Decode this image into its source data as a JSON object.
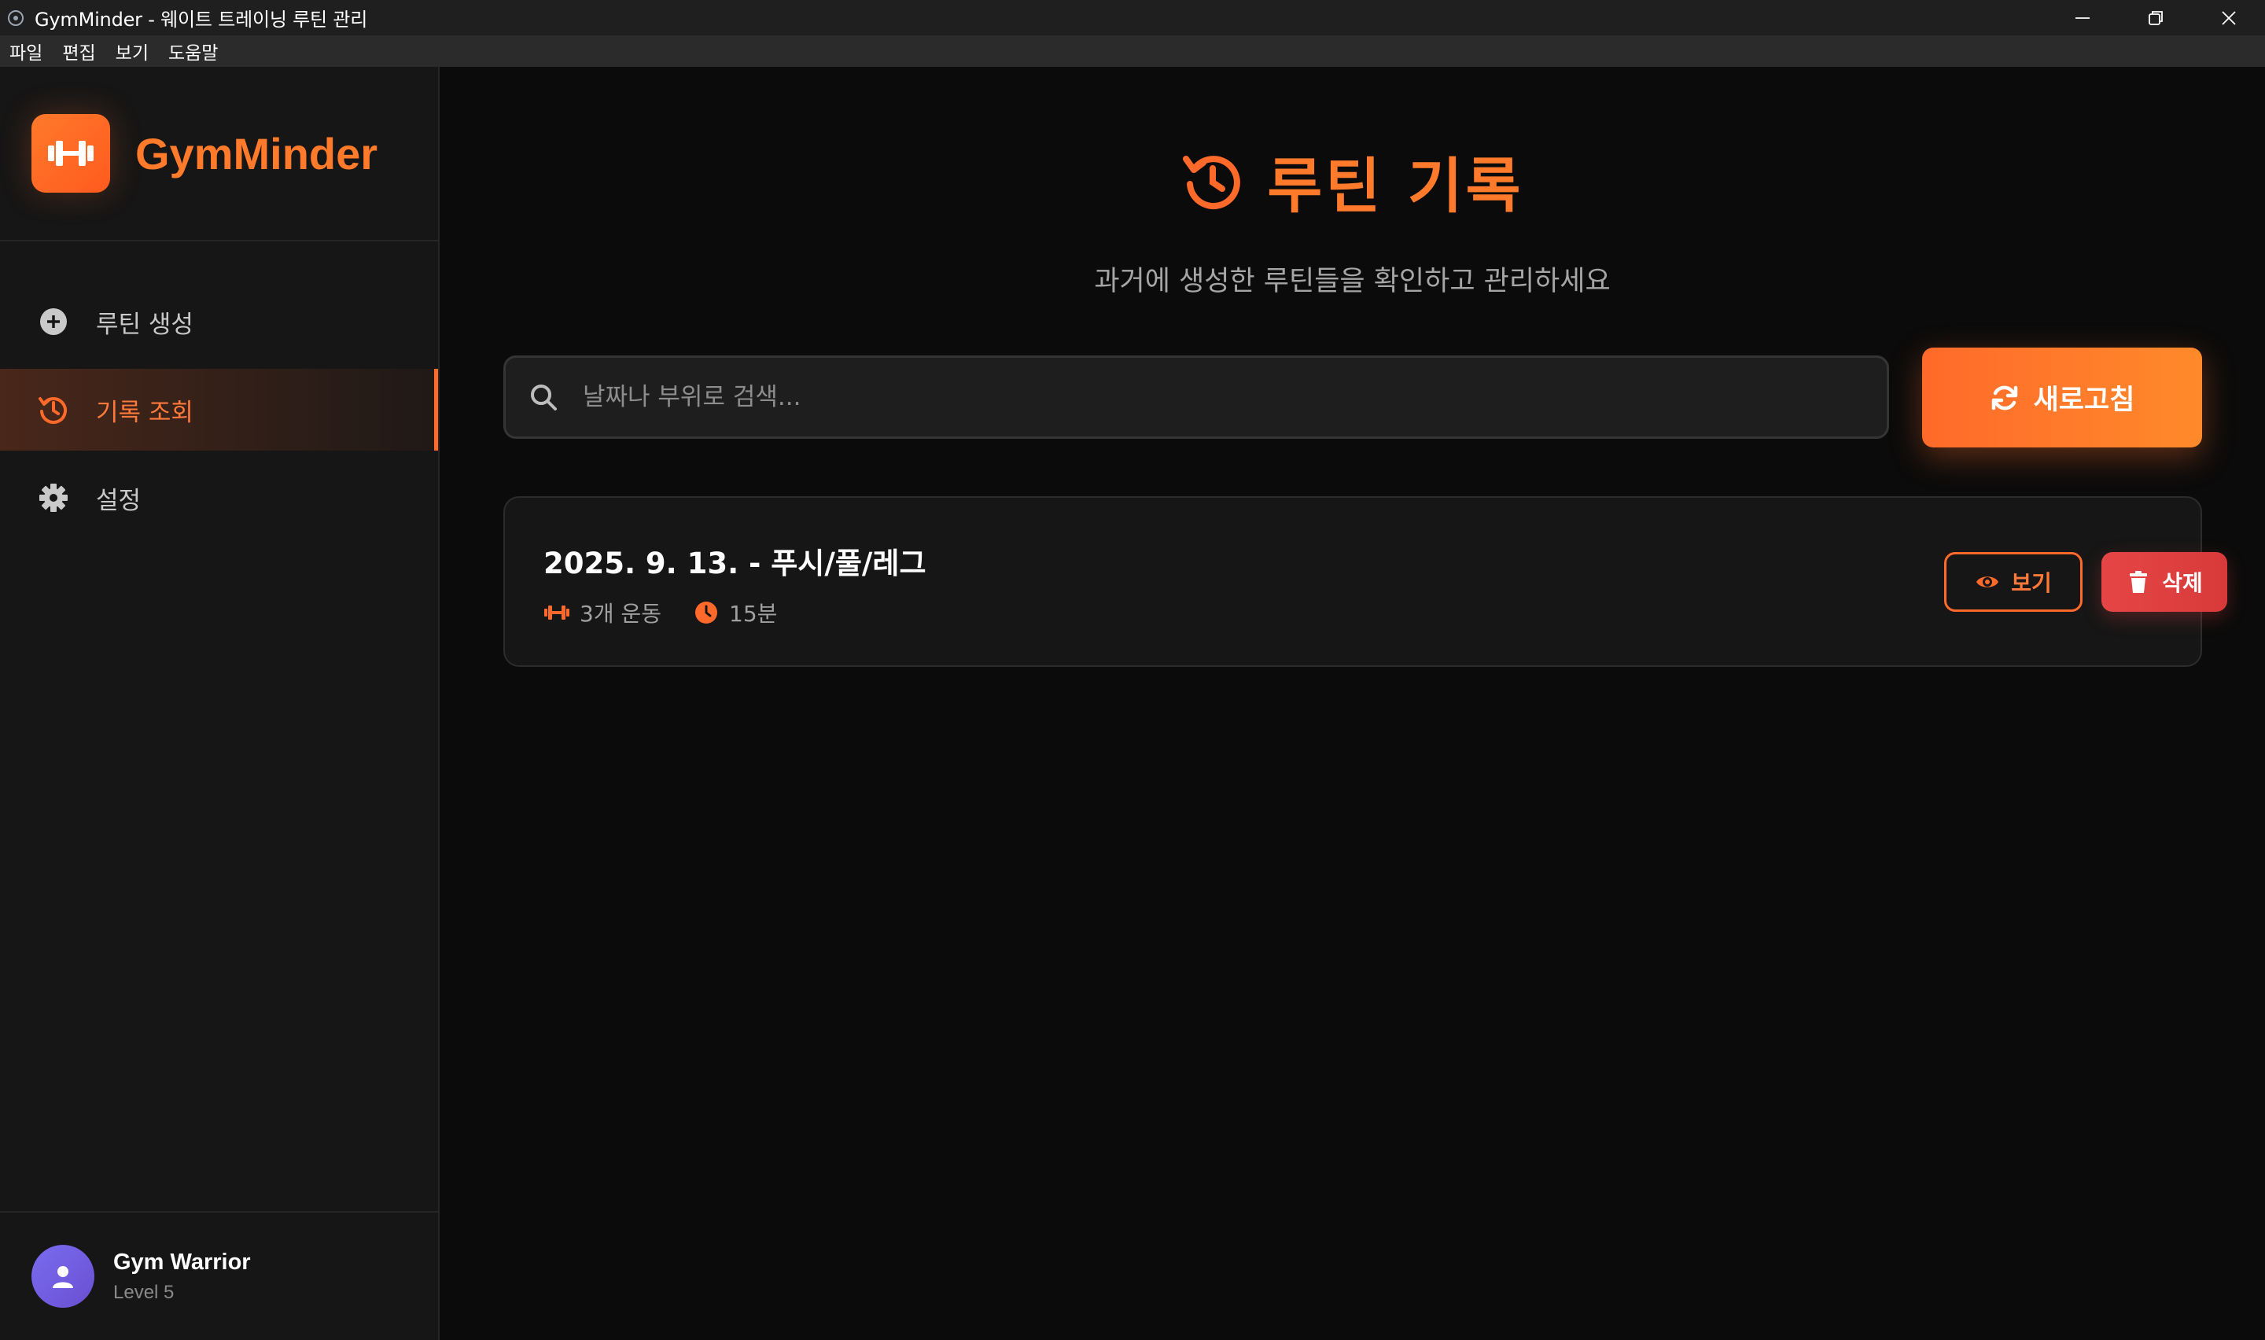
{
  "window": {
    "title": "GymMinder - 웨이트 트레이닝 루틴 관리",
    "controls": [
      "minimize-icon",
      "restore-icon",
      "close-icon"
    ]
  },
  "menu": {
    "items": [
      "파일",
      "편집",
      "보기",
      "도움말"
    ]
  },
  "sidebar": {
    "brand": "GymMinder",
    "nav": [
      {
        "label": "루틴 생성",
        "icon": "plus-circle-icon",
        "active": false
      },
      {
        "label": "기록 조회",
        "icon": "history-icon",
        "active": true
      },
      {
        "label": "설정",
        "icon": "gear-icon",
        "active": false
      }
    ],
    "user": {
      "name": "Gym Warrior",
      "level": "Level 5"
    }
  },
  "main": {
    "title": "루틴 기록",
    "subtitle": "과거에 생성한 루틴들을 확인하고 관리하세요",
    "search": {
      "placeholder": "날짜나 부위로 검색...",
      "value": ""
    },
    "refresh_label": "새로고침",
    "records": [
      {
        "title": "2025. 9. 13. - 푸시/풀/레그",
        "exercises": "3개 운동",
        "duration": "15분",
        "view_label": "보기",
        "delete_label": "삭제"
      }
    ]
  },
  "colors": {
    "accent": "#ff7a2a",
    "danger": "#e54545",
    "background": "#0b0b0b",
    "sidebar": "#161616"
  }
}
